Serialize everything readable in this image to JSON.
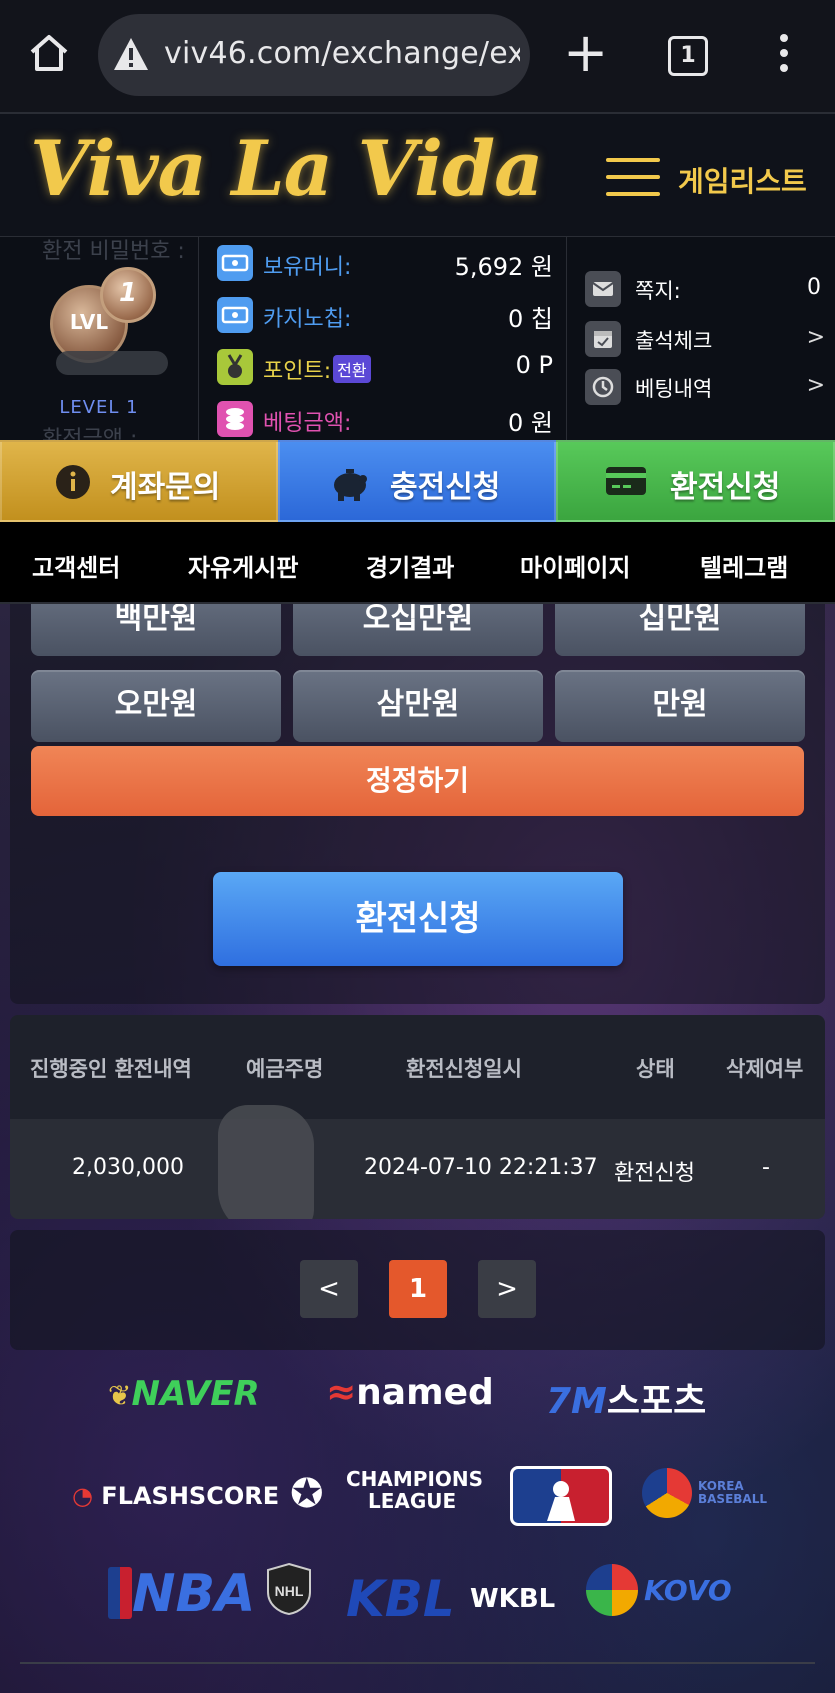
{
  "browser": {
    "url": "viv46.com/exchange/ex",
    "tab_count": "1",
    "icons": [
      "home-icon",
      "warning-icon",
      "plus-icon",
      "tabs-icon",
      "more-icon"
    ]
  },
  "header": {
    "logo": "Viva La Vida",
    "gamelist_label": "게임리스트"
  },
  "account": {
    "ghost_top": "환전 비밀번호 :",
    "ghost_bottom": "환전금액 :",
    "level_badge_lvl": "LVL",
    "level_badge_num": "1",
    "level_text": "LEVEL 1",
    "balances": [
      {
        "label": "보유머니:",
        "value": "5,692 원",
        "color": "#4f9cf0",
        "icon": "money-icon"
      },
      {
        "label": "카지노칩:",
        "value": "0 칩",
        "color": "#4f9cf0",
        "icon": "chip-icon"
      },
      {
        "label": "포인트:",
        "badge": "전환",
        "value": "0 P",
        "color": "#e8d24a",
        "icon": "medal-icon"
      },
      {
        "label": "베팅금액:",
        "value": "0 원",
        "color": "#e052b0",
        "icon": "coins-icon"
      }
    ],
    "links": [
      {
        "label": "쪽지:",
        "value": "0",
        "icon": "mail-icon"
      },
      {
        "label": "출석체크",
        "icon": "calendar-icon"
      },
      {
        "label": "베팅내역",
        "icon": "history-icon"
      }
    ]
  },
  "actions": {
    "account_inquiry": "계좌문의",
    "deposit": "충전신청",
    "withdraw": "환전신청"
  },
  "nav": [
    "고객센터",
    "자유게시판",
    "경기결과",
    "마이페이지",
    "텔레그램"
  ],
  "amounts": {
    "row1": [
      "백만원",
      "오십만원",
      "십만원"
    ],
    "row2": [
      "오만원",
      "삼만원",
      "만원"
    ],
    "reset": "정정하기",
    "apply": "환전신청"
  },
  "table": {
    "headers": [
      "진행중인 환전내역",
      "예금주명",
      "환전신청일시",
      "상태",
      "삭제여부"
    ],
    "rows": [
      {
        "amount": "2,030,000",
        "name": "",
        "datetime": "2024-07-10 22:21:37",
        "status": "환전신청",
        "delete": "-"
      }
    ]
  },
  "pagination": {
    "current": "1"
  },
  "partners": {
    "naver": "NAVER",
    "named": "named",
    "sports_7m": "7M",
    "sports_label": "스포츠",
    "flashscore": "FLASHSCORE",
    "champions": "CHAMPIONS",
    "league": "LEAGUE",
    "nba": "NBA",
    "nhl": "NHL",
    "kbl": "KBL",
    "wkbl": "WKBL",
    "kovo": "KOVO",
    "kbo": "KOREA BASEBALL"
  }
}
